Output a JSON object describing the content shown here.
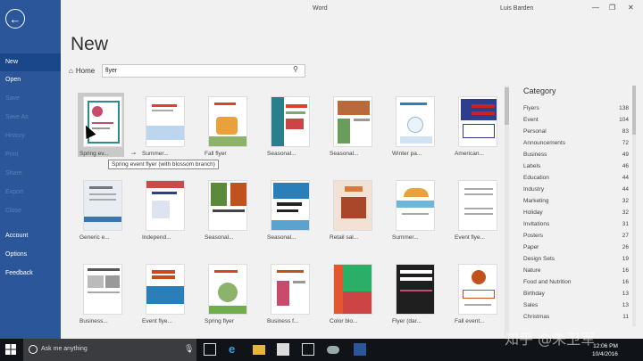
{
  "window": {
    "title": "Word",
    "user": "Luis Barden",
    "minimize": "—",
    "restore": "❐",
    "close": "✕"
  },
  "sidebar": {
    "items": [
      {
        "label": "New",
        "active": true
      },
      {
        "label": "Open"
      },
      {
        "label": "Save",
        "dim": true
      },
      {
        "label": "Save As",
        "dim": true
      },
      {
        "label": "History",
        "dim": true
      },
      {
        "label": "Print",
        "dim": true
      },
      {
        "label": "Share",
        "dim": true
      },
      {
        "label": "Export",
        "dim": true
      },
      {
        "label": "Close",
        "dim": true
      },
      {
        "label": "Account"
      },
      {
        "label": "Options"
      },
      {
        "label": "Feedback"
      }
    ]
  },
  "main": {
    "page_title": "New",
    "home_label": "Home",
    "search_value": "flyer",
    "tooltip": "Spring event flyer (with blossom branch)"
  },
  "templates": [
    "Spring ev...",
    "Summer...",
    "Fall flyer",
    "Seasonal...",
    "Seasonal...",
    "Winter pa...",
    "American...",
    "Generic e...",
    "Independ...",
    "Seasonal...",
    "Seasonal...",
    "Retail sal...",
    "Summer...",
    "Event flye...",
    "Business...",
    "Event flye...",
    "Spring flyer",
    "Business f...",
    "Color blo...",
    "Flyer (dar...",
    "Fall event..."
  ],
  "category": {
    "title": "Category",
    "rows": [
      {
        "name": "Flyers",
        "count": "138"
      },
      {
        "name": "Event",
        "count": "104"
      },
      {
        "name": "Personal",
        "count": "83"
      },
      {
        "name": "Announcements",
        "count": "72"
      },
      {
        "name": "Business",
        "count": "49"
      },
      {
        "name": "Labels",
        "count": "46"
      },
      {
        "name": "Education",
        "count": "44"
      },
      {
        "name": "Industry",
        "count": "44"
      },
      {
        "name": "Marketing",
        "count": "32"
      },
      {
        "name": "Holiday",
        "count": "32"
      },
      {
        "name": "Invitations",
        "count": "31"
      },
      {
        "name": "Posters",
        "count": "27"
      },
      {
        "name": "Paper",
        "count": "26"
      },
      {
        "name": "Design Sets",
        "count": "19"
      },
      {
        "name": "Nature",
        "count": "16"
      },
      {
        "name": "Food and Nutrition",
        "count": "16"
      },
      {
        "name": "Birthday",
        "count": "13"
      },
      {
        "name": "Sales",
        "count": "13"
      },
      {
        "name": "Christmas",
        "count": "11"
      }
    ]
  },
  "taskbar": {
    "search_placeholder": "Ask me anything",
    "time": "12:06 PM",
    "date": "10/4/2016"
  },
  "watermark": "知乎 @朱卫军"
}
